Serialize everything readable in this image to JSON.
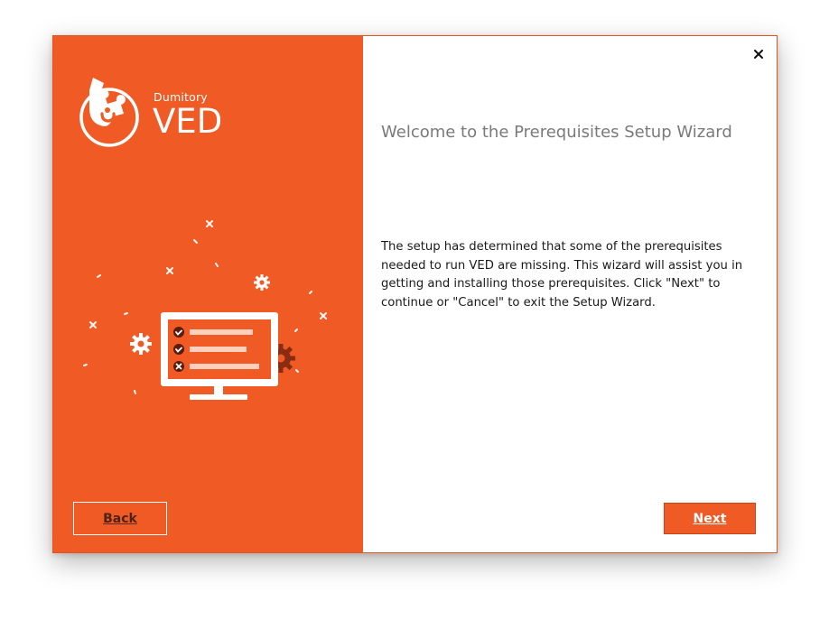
{
  "brand": {
    "company": "Dumitory",
    "product": "VED"
  },
  "wizard": {
    "title": "Welcome to the Prerequisites Setup Wizard",
    "body": "The setup has determined that some of the prerequisites needed to run VED are missing. This wizard will assist you in getting and installing those prerequisites. Click \"Next\" to continue or \"Cancel\" to exit the Setup Wizard."
  },
  "buttons": {
    "back": "Back",
    "next": "Next",
    "close": "close-icon"
  },
  "colors": {
    "accent": "#f05a24",
    "text": "#1a1a1a",
    "title": "#7a7a7a"
  },
  "illustration": {
    "icon": "monitor-checklist-icon",
    "checklist": [
      {
        "status": "check"
      },
      {
        "status": "check"
      },
      {
        "status": "cross"
      }
    ]
  }
}
